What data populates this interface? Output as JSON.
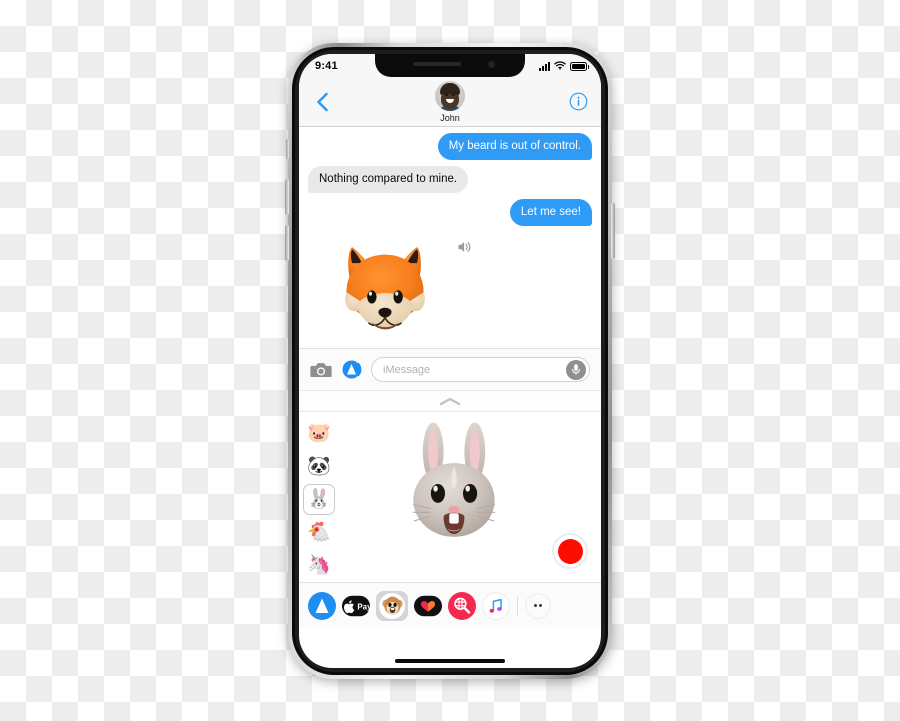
{
  "device": {
    "name": "iPhone X"
  },
  "status_bar": {
    "time": "9:41",
    "signal_icon": "cellular-bars-icon",
    "wifi_icon": "wifi-icon",
    "battery_icon": "battery-icon"
  },
  "nav_bar": {
    "back_icon": "back-chevron-icon",
    "contact_name": "John",
    "avatar_icon": "contact-avatar",
    "info_icon": "info-icon"
  },
  "conversation": {
    "messages": [
      {
        "text": "My beard is out of control.",
        "direction": "outgoing"
      },
      {
        "text": "Nothing compared to mine.",
        "direction": "incoming"
      },
      {
        "text": "Let me see!",
        "direction": "outgoing"
      }
    ],
    "animoji_message": {
      "character": "fox",
      "speaker_icon": "speaker-volume-icon"
    }
  },
  "input_bar": {
    "camera_icon": "camera-icon",
    "appstore_icon": "app-store-icon",
    "placeholder": "iMessage",
    "value": "",
    "mic_icon": "microphone-icon"
  },
  "grabber": {
    "icon": "chevron-up-icon"
  },
  "animoji_panel": {
    "characters": [
      {
        "name": "pig",
        "glyph": "🐷",
        "selected": false
      },
      {
        "name": "panda",
        "glyph": "🐼",
        "selected": false
      },
      {
        "name": "rabbit",
        "glyph": "🐰",
        "selected": true
      },
      {
        "name": "chicken",
        "glyph": "🐔",
        "selected": false
      },
      {
        "name": "unicorn",
        "glyph": "🦄",
        "selected": false
      }
    ],
    "preview_character": "rabbit",
    "record_button_label": "record"
  },
  "app_drawer": {
    "apps": [
      {
        "name": "app-store",
        "label": "App Store",
        "color": "#1e8ef0"
      },
      {
        "name": "apple-pay",
        "label": "Apple Pay",
        "color": "#111111"
      },
      {
        "name": "animoji",
        "label": "Animoji",
        "color": "#ffffff",
        "selected": true
      },
      {
        "name": "digital-touch",
        "label": "Digital Touch",
        "color": "#111111"
      },
      {
        "name": "images",
        "label": "#images",
        "color": "#f5294f"
      },
      {
        "name": "music",
        "label": "Music",
        "color": "#ffffff"
      }
    ],
    "more_icon": "more-apps-icon"
  },
  "colors": {
    "outgoing_bubble": "#2e9bf7",
    "incoming_bubble": "#e9e9eb",
    "record_red": "#fb0d00",
    "accent_blue": "#2e9bf7"
  }
}
